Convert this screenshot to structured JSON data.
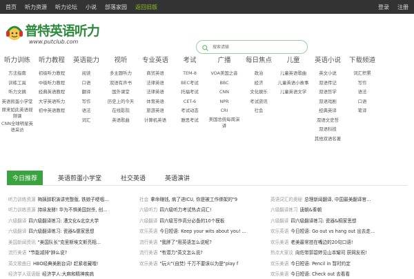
{
  "topbar": {
    "left": [
      "首页",
      "听力资源",
      "听力论坛",
      "小说",
      "部落家园",
      "返回旧版"
    ],
    "right": [
      "登录",
      "注册"
    ]
  },
  "logo": {
    "name": "普特英语听力",
    "url": "www.putclub.com"
  },
  "search": {
    "placeholder": "搜索请输"
  },
  "nav": [
    {
      "head": "听力训练",
      "items": [
        "方法指南",
        "训练工具",
        "听力文摘",
        "英语煎蛋小学堂",
        "原来如此英语视频课",
        "CNN全球明星英语采访"
      ]
    },
    {
      "head": "听力教程",
      "items": [
        "初级听力教程",
        "中级听力教程",
        "经典英语教程",
        "大学英语听力",
        "初中英语教程"
      ]
    },
    {
      "head": "英语能力",
      "items": [
        "阅读",
        "口语",
        "翻译",
        "写作",
        "语法",
        "词汇"
      ]
    },
    {
      "head": "视听",
      "items": [
        "多主题听力",
        "双语有声书",
        "国外课堂",
        "历史上的今天",
        "在线影院",
        "英语歌曲"
      ]
    },
    {
      "head": "专业英语",
      "items": [
        "商贸英语",
        "法律英语",
        "法律英语",
        "体育英语",
        "旅游英语",
        "计算机英语"
      ]
    },
    {
      "head": "考试",
      "items": [
        "TEM-8",
        "BEC考试",
        "托福考试",
        "CET-6",
        "考试动态",
        "雅思考试"
      ]
    },
    {
      "head": "广播",
      "items": [
        "VOA美国之音",
        "BBC",
        "CNN",
        "NPR",
        "CRI",
        "美国总统每周演讲"
      ]
    },
    {
      "head": "每日焦点",
      "items": [
        "政治",
        "经济",
        "文化娱乐",
        "考试资讯",
        "社会"
      ]
    },
    {
      "head": "儿童",
      "items": [
        "儿童英语歌曲",
        "儿童英语小故事",
        "儿童英语文学"
      ]
    },
    {
      "head": "英语小说",
      "items": [
        "英文小说",
        "双语传记",
        "双语哲学",
        "双语戏剧",
        "经典英译",
        "双语文史哲",
        "双语科技",
        "其他双语名著"
      ]
    },
    {
      "head": "下载频道",
      "items": [
        "词汇积累",
        "写作",
        "语法",
        "口语",
        "笔译"
      ]
    }
  ],
  "tabs": [
    "今日推荐",
    "英语煎蛋小学堂",
    "社交英语",
    "英语演讲"
  ],
  "news": [
    [
      {
        "cat": "听力训练资源",
        "title": "梅姨辞职演讲完整版, 铁娘子哽咽..."
      },
      {
        "cat": "社会",
        "title": "拿命赚钱, 病了进ICU, 你是被工作绑架的\"9"
      },
      {
        "cat": "英语词汇的奥秘",
        "title": "总理新闻翻译, 中国最美翻译官..."
      }
    ],
    [
      {
        "cat": "听力训练资源",
        "title": "持续发酵! 华为不惧美国封杀, 创..."
      },
      {
        "cat": "六级听力",
        "title": "四六级听力考试热点词汇!"
      },
      {
        "cat": "六级翻译练习",
        "title": "唐朝&秦朝"
      }
    ],
    [
      {
        "cat": "六级翻译",
        "title": "四六级翻译练习: 漕文化&北京大学"
      },
      {
        "cat": "六级翻译",
        "title": "四六级写作高分必备的10个模板"
      },
      {
        "cat": "六级翻译",
        "title": "四六级翻译练习: 瓷器&桐家思想"
      }
    ],
    [
      {
        "cat": "六级翻译",
        "title": "四六级翻译练习: 瓷器&儒家思想"
      },
      {
        "cat": "欢乐英语",
        "title": "今日短语: Keep your wits about you! ..."
      },
      {
        "cat": "欢乐英语",
        "title": "今日短语: Go out vs hang out 出去走..."
      }
    ],
    [
      {
        "cat": "美国新闻资讯",
        "title": "\"美国队长\"克里斯埃文斯亮相..."
      },
      {
        "cat": "流行美语",
        "title": "\"我胖了\"用英语怎么说呢?"
      },
      {
        "cat": "欢乐美语",
        "title": "老美最常挂在嘴边的20句口语!"
      }
    ],
    [
      {
        "cat": "流行美语",
        "title": "\"节能减排\"肿么说?"
      },
      {
        "cat": "流行美语",
        "title": "\"有潜力\"英文怎么说?"
      },
      {
        "cat": "热点大家议",
        "title": "向佐带郭碧婷见山本耀司 获网友祝!"
      }
    ],
    [
      {
        "cat": "英文歌曲日",
        "title": "HBO经典美剧台词! 赶紧收藏哦!"
      },
      {
        "cat": "欢乐美语",
        "title": "\"玩火\"(自焚) 千万不要误以为是\"play f"
      },
      {
        "cat": "欢乐美语",
        "title": "今日短语: Pencil in 暂时约定"
      }
    ],
    [
      {
        "cat": "经济学人双语版",
        "title": "经济学人:大麻和精神疾病"
      },
      {
        "cat": "",
        "title": ""
      },
      {
        "cat": "欢乐美语",
        "title": "今日短语: Check out 去看看"
      }
    ]
  ]
}
